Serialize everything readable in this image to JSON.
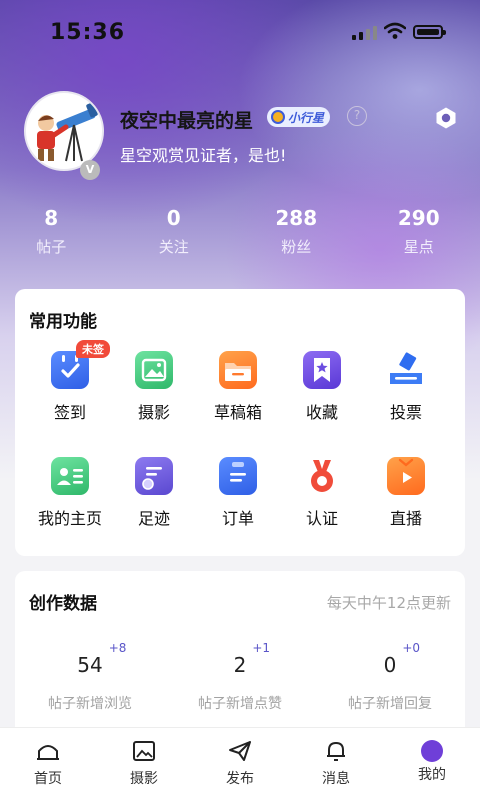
{
  "status_bar": {
    "time": "15:36"
  },
  "profile": {
    "name": "夜空中最亮的星",
    "level_badge": "小行星",
    "bio": "星空观赏见证者，是也!",
    "verified_mark": "V"
  },
  "stats": [
    {
      "value": "8",
      "label": "帖子"
    },
    {
      "value": "0",
      "label": "关注"
    },
    {
      "value": "288",
      "label": "粉丝"
    },
    {
      "value": "290",
      "label": "星点"
    }
  ],
  "common_functions": {
    "title": "常用功能",
    "checkin_tag": "未签",
    "items": [
      {
        "label": "签到",
        "icon": "calendar-check-icon",
        "color": "#3d6bf0"
      },
      {
        "label": "摄影",
        "icon": "photo-icon",
        "color": "#34c47a"
      },
      {
        "label": "草稿箱",
        "icon": "folder-icon",
        "color": "#ff7a2e"
      },
      {
        "label": "收藏",
        "icon": "bookmark-star-icon",
        "color": "#6b4de0"
      },
      {
        "label": "投票",
        "icon": "ballot-icon",
        "color": "#2f6df0"
      },
      {
        "label": "我的主页",
        "icon": "profile-card-icon",
        "color": "#34c47a"
      },
      {
        "label": "足迹",
        "icon": "footprint-icon",
        "color": "#6a55d8"
      },
      {
        "label": "订单",
        "icon": "clipboard-icon",
        "color": "#3d6bf0"
      },
      {
        "label": "认证",
        "icon": "medal-icon",
        "color": "#f04c3a"
      },
      {
        "label": "直播",
        "icon": "tv-play-icon",
        "color": "#ff7a2e"
      }
    ]
  },
  "creation_data": {
    "title": "创作数据",
    "update_note": "每天中午12点更新",
    "metrics": [
      {
        "value": "54",
        "delta": "+8",
        "label": "帖子新增浏览"
      },
      {
        "value": "2",
        "delta": "+1",
        "label": "帖子新增点赞"
      },
      {
        "value": "0",
        "delta": "+0",
        "label": "帖子新增回复"
      }
    ]
  },
  "tabbar": [
    {
      "label": "首页",
      "icon": "home-icon"
    },
    {
      "label": "摄影",
      "icon": "image-icon"
    },
    {
      "label": "发布",
      "icon": "send-icon"
    },
    {
      "label": "消息",
      "icon": "bell-icon"
    },
    {
      "label": "我的",
      "icon": "mine-icon",
      "active": true
    }
  ]
}
